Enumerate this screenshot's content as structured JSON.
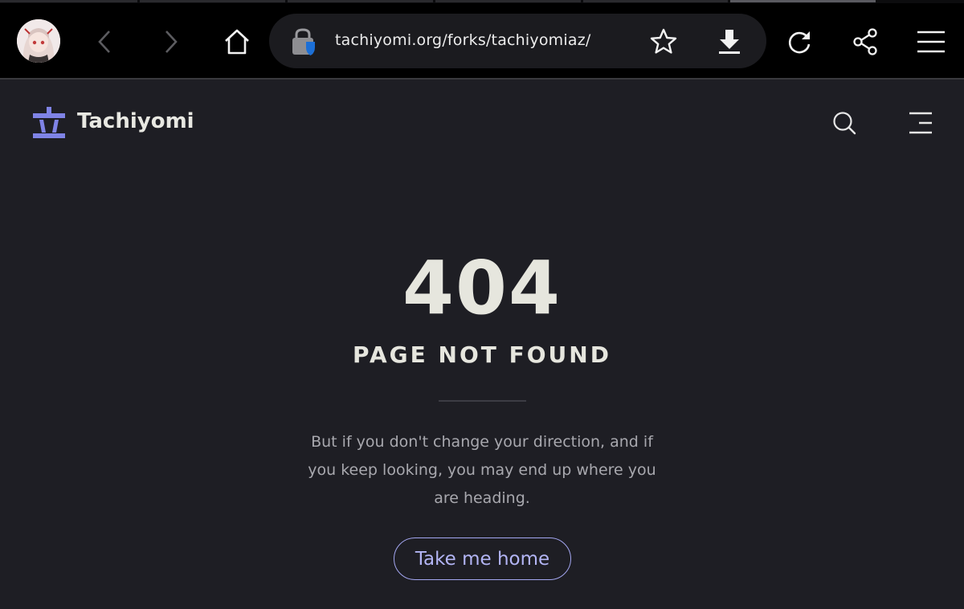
{
  "browser": {
    "url": "tachiyomi.org/forks/tachiyomiaz/",
    "icons": {
      "avatar": "user-avatar",
      "back": "chevron-left-icon",
      "forward": "chevron-right-icon",
      "home": "home-icon",
      "site_security": "lock-shield-icon",
      "bookmark": "star-icon",
      "download": "download-icon",
      "reload": "reload-icon",
      "share": "share-icon",
      "menu": "hamburger-menu-icon"
    }
  },
  "site": {
    "name": "Tachiyomi",
    "accent_color": "#7f83e6",
    "icons": {
      "logo": "tachiyomi-logo",
      "search": "search-icon",
      "menu": "menu-icon"
    }
  },
  "error": {
    "code": "404",
    "title": "PAGE NOT FOUND",
    "message": "But if you don't change your direction, and if you keep looking, you may end up where you are heading.",
    "home_button": "Take me home"
  }
}
